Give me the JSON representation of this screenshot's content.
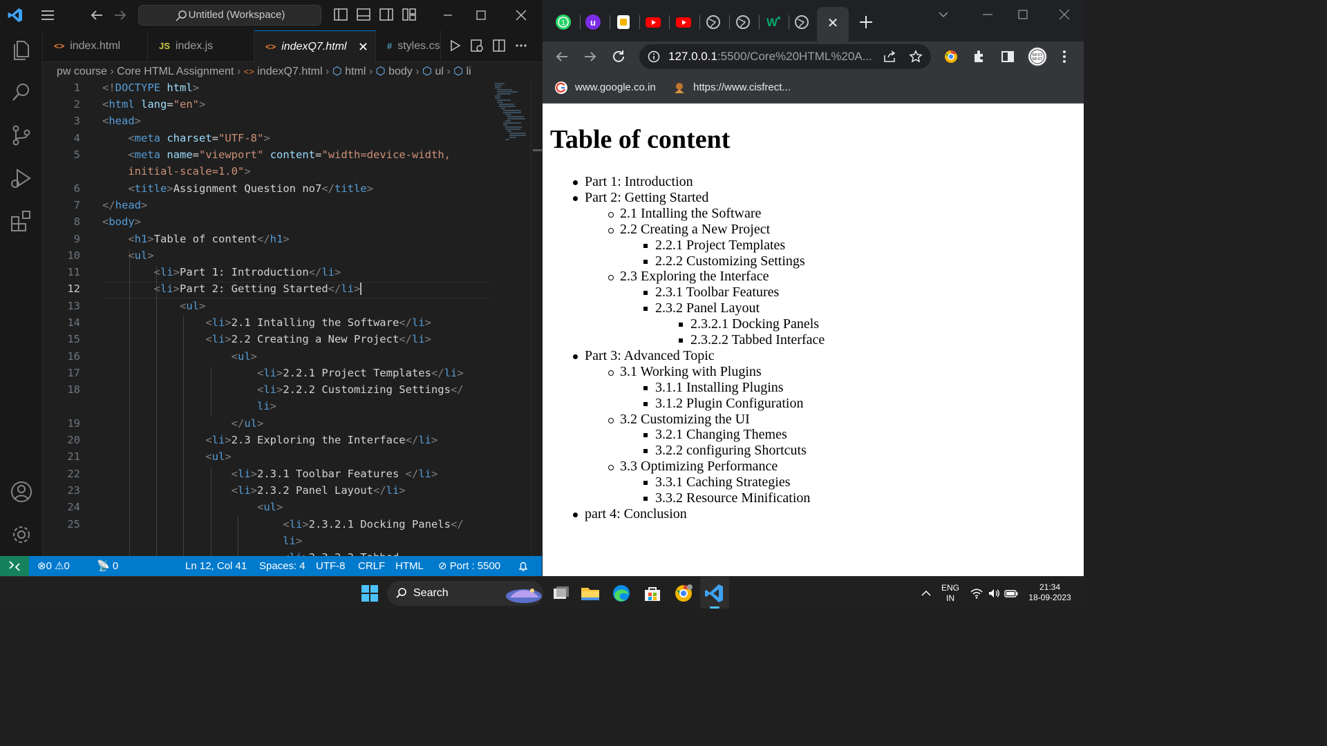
{
  "vscode": {
    "title_search": "Untitled (Workspace)",
    "tabs": [
      {
        "icon": "<>",
        "label": "index.html"
      },
      {
        "icon": "JS",
        "label": "index.js"
      },
      {
        "icon": "<>",
        "label": "indexQ7.html"
      },
      {
        "icon": "#",
        "label": "styles.cs"
      }
    ],
    "breadcrumb": [
      "pw course",
      "Core HTML Assignment",
      "indexQ7.html",
      "html",
      "body",
      "ul",
      "li"
    ],
    "line_numbers": [
      "1",
      "2",
      "3",
      "4",
      "5",
      "",
      "6",
      "7",
      "8",
      "9",
      "10",
      "11",
      "12",
      "13",
      "14",
      "15",
      "16",
      "17",
      "18",
      "",
      "19",
      "20",
      "21",
      "22",
      "23",
      "24",
      "25",
      "",
      ""
    ],
    "status": {
      "errors": "0",
      "warnings": "0",
      "ports": "0",
      "position": "Ln 12, Col 41",
      "spaces": "Spaces: 4",
      "encoding": "UTF-8",
      "eol": "CRLF",
      "language": "HTML",
      "port": "Port : 5500"
    }
  },
  "chrome": {
    "url_host": "127.0.0.1",
    "url_path": ":5500/Core%20HTML%20A...",
    "bookmarks": [
      "www.google.co.in",
      "https://www.cisfrect..."
    ],
    "page": {
      "heading": "Table of content",
      "items": [
        {
          "level": 1,
          "text": "Part 1: Introduction"
        },
        {
          "level": 1,
          "text": "Part 2: Getting Started"
        },
        {
          "level": 2,
          "text": "2.1 Intalling the Software"
        },
        {
          "level": 2,
          "text": "2.2 Creating a New Project"
        },
        {
          "level": 3,
          "text": "2.2.1 Project Templates"
        },
        {
          "level": 3,
          "text": "2.2.2 Customizing Settings"
        },
        {
          "level": 2,
          "text": "2.3 Exploring the Interface"
        },
        {
          "level": 3,
          "text": "2.3.1 Toolbar Features"
        },
        {
          "level": 3,
          "text": "2.3.2 Panel Layout"
        },
        {
          "level": 4,
          "text": "2.3.2.1 Docking Panels"
        },
        {
          "level": 4,
          "text": "2.3.2.2 Tabbed Interface"
        },
        {
          "level": 1,
          "text": "Part 3: Advanced Topic"
        },
        {
          "level": 2,
          "text": "3.1 Working with Plugins"
        },
        {
          "level": 3,
          "text": "3.1.1 Installing Plugins"
        },
        {
          "level": 3,
          "text": "3.1.2 Plugin Configuration"
        },
        {
          "level": 2,
          "text": "3.2 Customizing the UI"
        },
        {
          "level": 3,
          "text": "3.2.1 Changing Themes"
        },
        {
          "level": 3,
          "text": "3.2.2 configuring Shortcuts"
        },
        {
          "level": 2,
          "text": "3.3 Optimizing Performance"
        },
        {
          "level": 3,
          "text": "3.3.1 Caching Strategies"
        },
        {
          "level": 3,
          "text": "3.3.2 Resource Minification"
        },
        {
          "level": 1,
          "text": "part 4: Conclusion"
        }
      ]
    }
  },
  "taskbar": {
    "search": "Search",
    "lang": "ENG",
    "region": "IN",
    "time": "21:34",
    "date": "18-09-2023"
  },
  "colors": {
    "vscode_status": "#007acc",
    "vscode_accent": "#0078d4",
    "chrome_frame": "#202124",
    "chrome_toolbar": "#35363a"
  }
}
